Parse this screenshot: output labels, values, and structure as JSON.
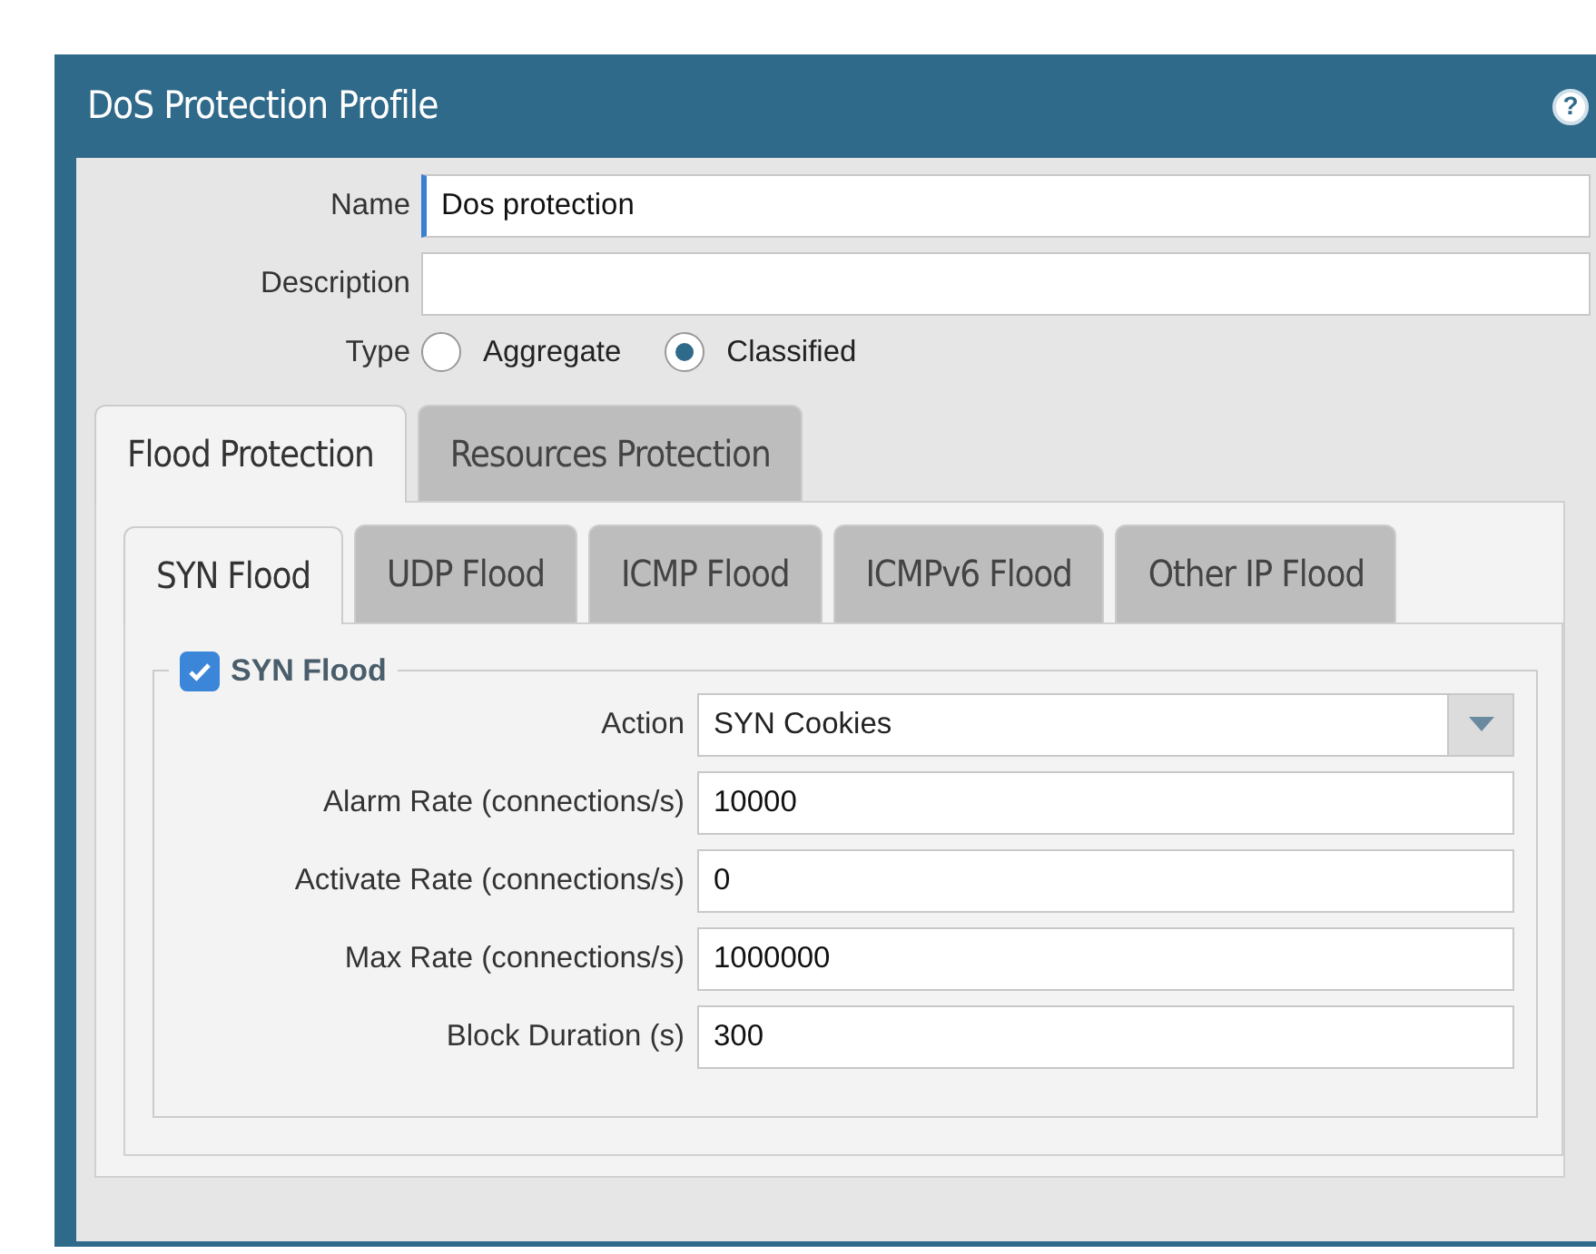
{
  "window": {
    "title": "DoS Protection Profile",
    "help": "?"
  },
  "form": {
    "name": {
      "label": "Name",
      "value": "Dos protection",
      "focused": true
    },
    "description": {
      "label": "Description"
    },
    "type": {
      "label": "Type",
      "options": [
        {
          "label": "Aggregate",
          "selected": false
        },
        {
          "label": "Classified",
          "selected": true
        }
      ]
    }
  },
  "tabs": [
    {
      "label": "Flood Protection",
      "selected": true
    },
    {
      "label": "Resources Protection",
      "selected": false
    }
  ],
  "subtabs": [
    {
      "label": "SYN Flood",
      "selected": true
    },
    {
      "label": "UDP Flood",
      "selected": false
    },
    {
      "label": "ICMP Flood",
      "selected": false
    },
    {
      "label": "ICMPv6 Flood",
      "selected": false
    },
    {
      "label": "Other IP Flood",
      "selected": false
    }
  ],
  "section": {
    "title": "SYN Flood",
    "checked": true,
    "fields": [
      {
        "kind": "select",
        "label": "Action",
        "value": "SYN Cookies"
      },
      {
        "kind": "text",
        "label": "Alarm Rate (connections/s)",
        "value": "10000"
      },
      {
        "kind": "text",
        "label": "Activate Rate (connections/s)",
        "value": "0"
      },
      {
        "kind": "text",
        "label": "Max Rate (connections/s)",
        "value": "1000000"
      },
      {
        "kind": "text",
        "label": "Block Duration (s)",
        "value": "300"
      }
    ]
  }
}
